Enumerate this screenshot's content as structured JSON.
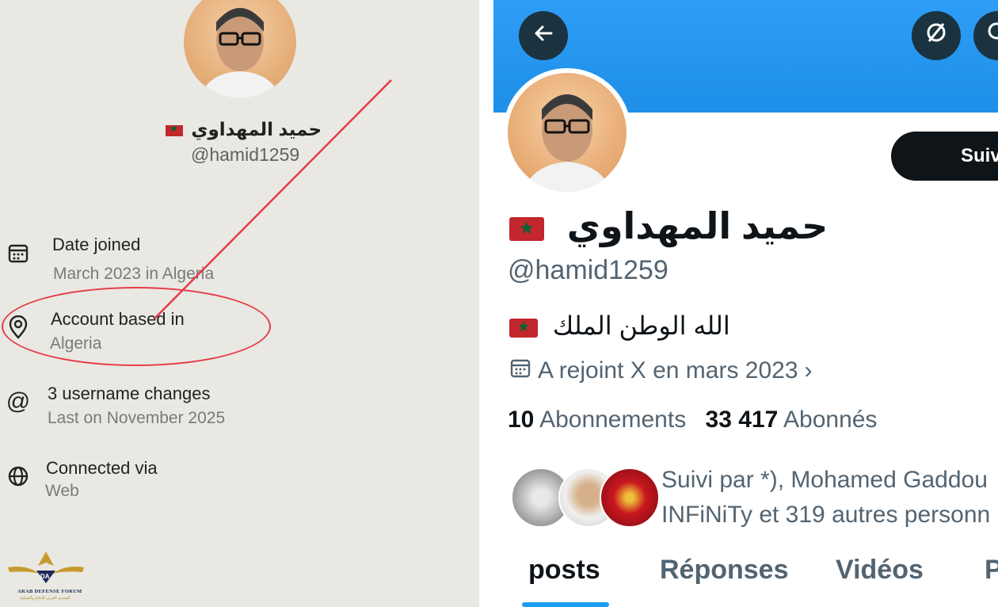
{
  "left": {
    "display_name": "حميد المهداوي",
    "handle": "@hamid1259",
    "details": [
      {
        "title": "Date joined",
        "sub": "March 2023 in Algeria",
        "icon": "calendar-icon"
      },
      {
        "title": "Account based in",
        "sub": "Algeria",
        "icon": "location-pin-icon"
      },
      {
        "title": "3 username changes",
        "sub": "Last on November 2025",
        "icon": "at-sign-icon"
      },
      {
        "title": "Connected via",
        "sub": "Web",
        "icon": "globe-icon"
      }
    ],
    "watermark": {
      "line1": "ARAB DEFENSE FORUM",
      "line2": "المنتدى العربي للدفاع والتسليح"
    }
  },
  "right": {
    "display_name": "حميد المهداوي",
    "handle": "@hamid1259",
    "follow_button": "Suiv",
    "bio": "الله الوطن الملك",
    "joined": "A rejoint X en mars 2023",
    "following_count": "10",
    "following_label": "Abonnements",
    "followers_count": "33 417",
    "followers_label": "Abonnés",
    "followed_by_line1": "Suivi par *), Mohamed Gaddou",
    "followed_by_line2": "INFiNiTy et 319 autres personn",
    "tabs": [
      "posts",
      "Réponses",
      "Vidéos",
      "P"
    ],
    "active_tab": "posts"
  },
  "colors": {
    "accent": "#1d9bf0",
    "banner": "#1d8fe8",
    "annotation": "#e53b47"
  }
}
